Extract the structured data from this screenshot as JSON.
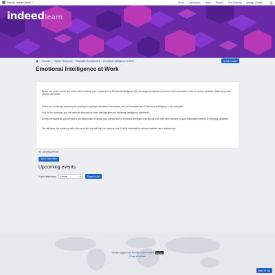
{
  "topbar": {
    "user_name": "Remote Learner Admin",
    "nav": [
      "Home",
      "Dashboards",
      "Tasks",
      "Reports",
      "Find Learning",
      "Manage Content"
    ]
  },
  "brand": {
    "main": "indeed",
    "sub": "learn"
  },
  "breadcrumb": [
    "Courses",
    "Human Resources",
    "Employee Development",
    "Emotional Intelligence at Work"
  ],
  "exit_button": "Exit Course",
  "page_title": "Emotional Intelligence at Work",
  "content": {
    "paragraphs": [
      "By the end of this course you will be able to identify your current level of Emotional Intelligence (EI) and apply techniques to common work scenarios in order to achieve healthier relationships with yourself and others.",
      "This is an introductory workshop for employees wanting to familiarize themselves with the fundamentals of Emotional Intelligence in the workplace.",
      "Prior to the workshop, you will watch an introductory video that highlights the Emotional Intelligence framework.",
      "During the workshop, you will take a self-assessment to gauge your current level of emotional intelligence as well as work with other learners to apply techniques learned, to everyday situations.",
      "You will leave this workshop with a few quick tips that will help you improve your EI skills holistically to achieve healthier work relationships."
    ]
  },
  "events": {
    "no_events_text": "No upcoming events",
    "add_button": "Add a new event",
    "section_title": "Upcoming events",
    "export_label": "Export attendance",
    "format_value": "Format",
    "export_button": "Export to file"
  },
  "footer": {
    "logged_in_prefix": "You are logged in as",
    "user_link": "Remote Learner Admin",
    "logout": "Log out",
    "purge": "Purge all caches",
    "back_to_top": "Back To Top"
  },
  "colors": {
    "banner_base": "#6a2aa8",
    "banner_magenta": "#c23ab8",
    "banner_violet": "#8a3ad6",
    "primary_button": "#1b63c6",
    "link": "#1b4e9b"
  }
}
